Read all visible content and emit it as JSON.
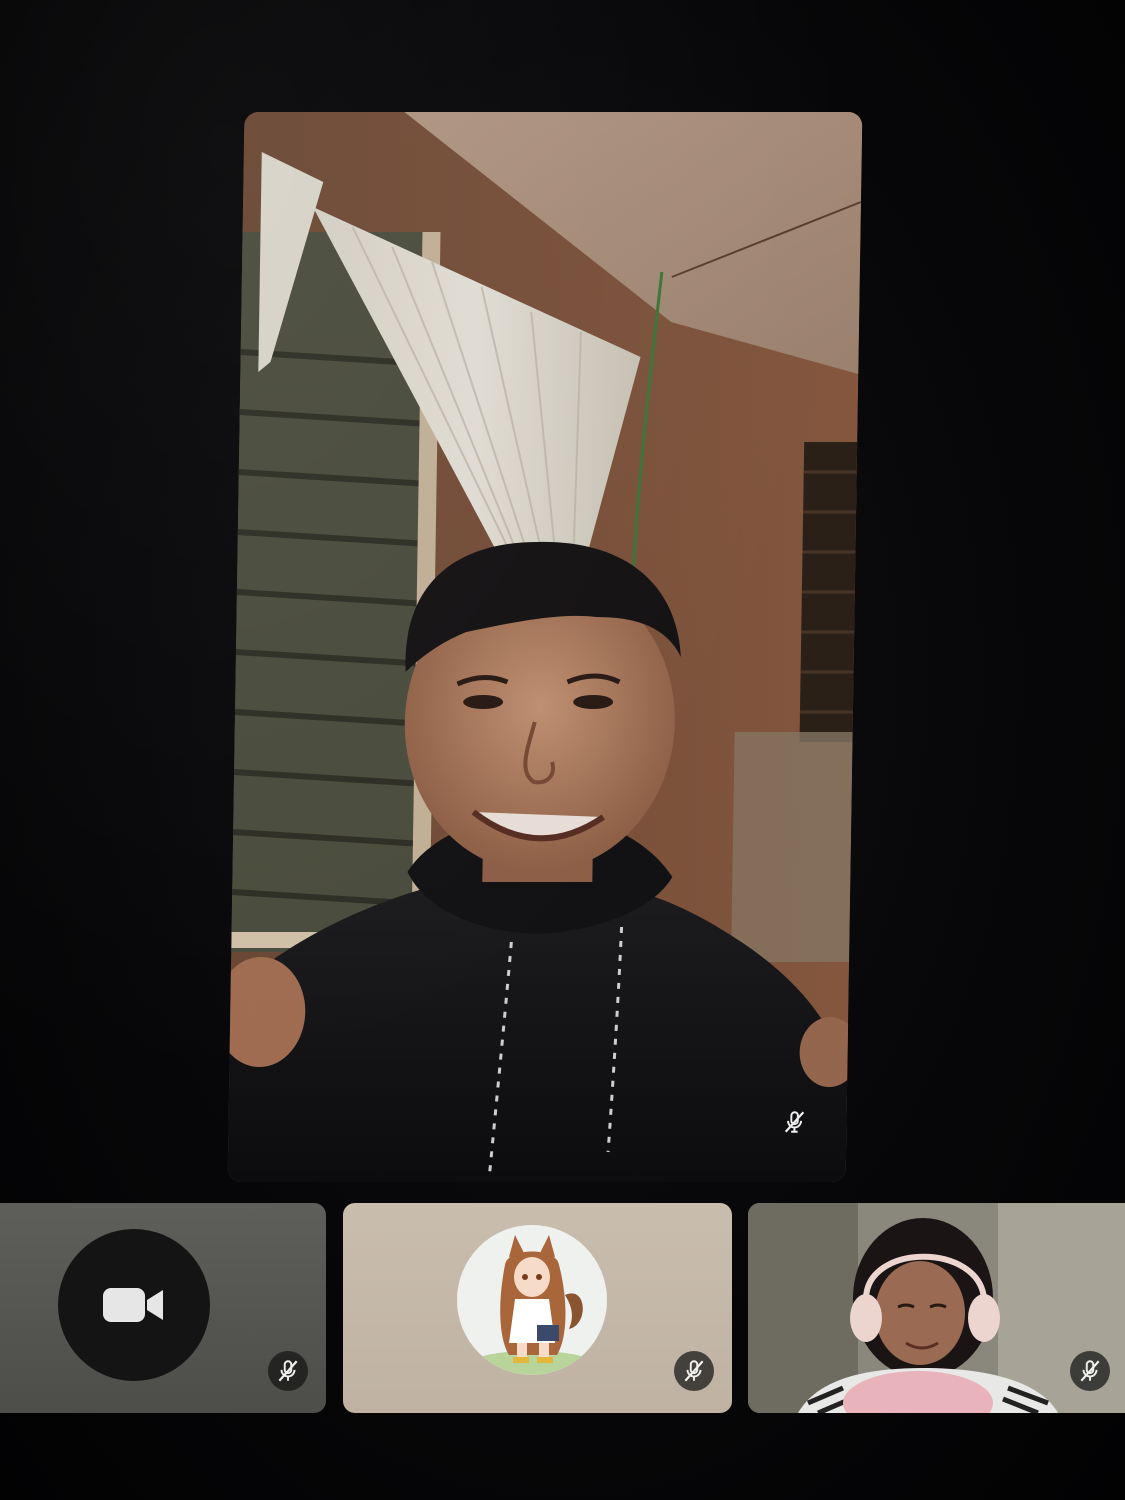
{
  "call": {
    "main_participant": {
      "video": "live-camera",
      "muted": true,
      "mute_icon": "mic-slash-icon"
    },
    "participants": [
      {
        "tile": "camera-off",
        "icon": "video-camera-icon",
        "muted": true,
        "mute_icon": "mic-slash-icon"
      },
      {
        "tile": "avatar",
        "icon": "anime-avatar-icon",
        "muted": true,
        "mute_icon": "mic-slash-icon"
      },
      {
        "tile": "live-camera",
        "muted": true,
        "mute_icon": "mic-slash-icon"
      }
    ]
  },
  "colors": {
    "background": "#050506",
    "tile_gray": "#575754",
    "tile_beige": "#c6b9a9",
    "badge": "#141414"
  }
}
